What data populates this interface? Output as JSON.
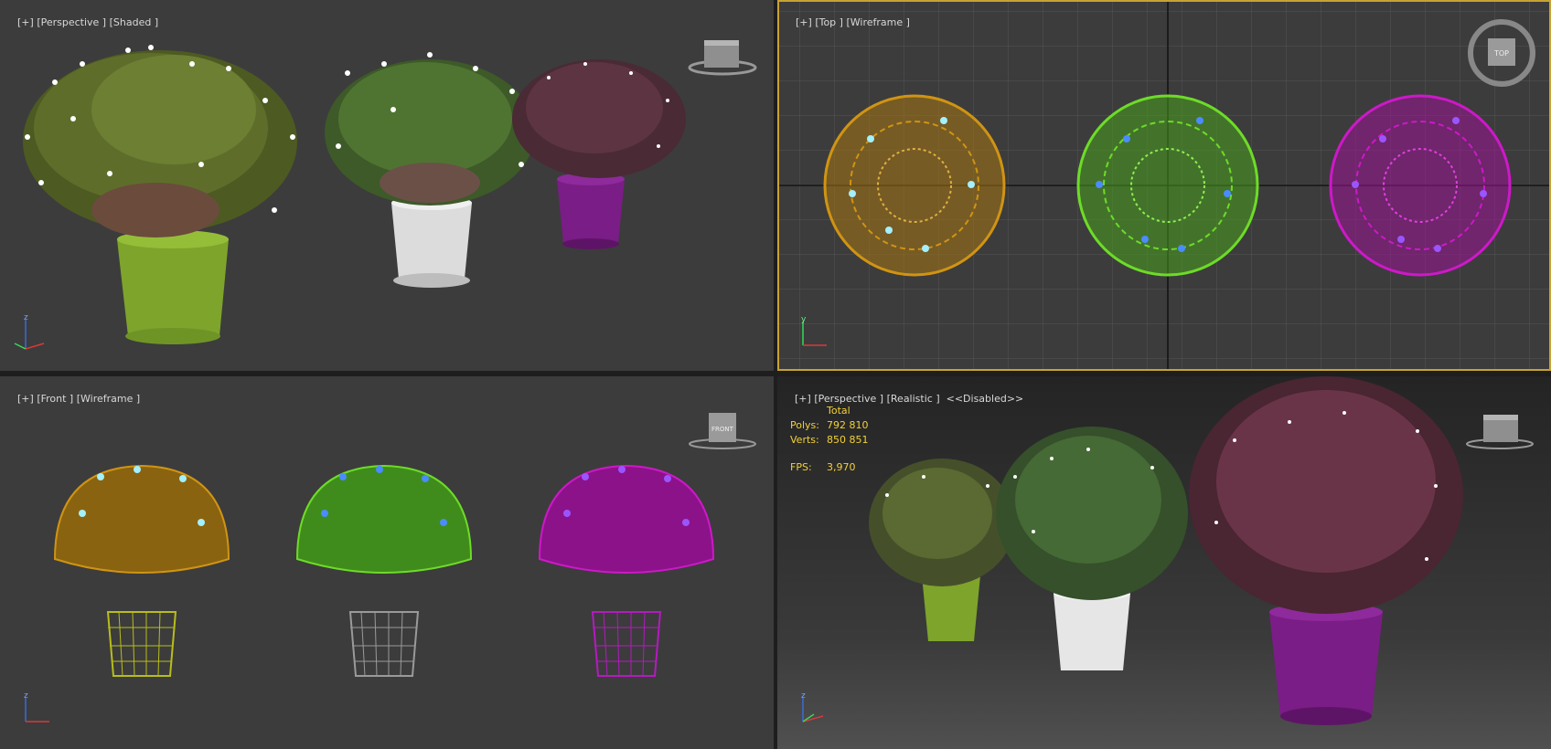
{
  "colors": {
    "viewport_bg": "#3c3c3c",
    "viewport_active_border": "#c8a233",
    "separator": "#1e1e1e",
    "stats_text": "#f3d036",
    "label_text": "#d8d8d8",
    "pot_green": "#8bb231",
    "pot_white": "#e6e6e6",
    "pot_purple": "#7a1d86",
    "wire_orange": "#d09413",
    "wire_green": "#6ddc28",
    "wire_magenta": "#cd19c8",
    "flower_cyan": "#a3f0ff",
    "flower_blue": "#4a8cff",
    "flower_violet": "#9a55ff"
  },
  "viewports": {
    "top_left": {
      "plus": "[+]",
      "view": "[Perspective ]",
      "mode": "[Shaded ]"
    },
    "top_right": {
      "plus": "[+]",
      "view": "[Top ]",
      "mode": "[Wireframe ]",
      "viewcube_label": "TOP"
    },
    "bottom_left": {
      "plus": "[+]",
      "view": "[Front ]",
      "mode": "[Wireframe ]",
      "viewcube_label": "FRONT"
    },
    "bottom_right": {
      "plus": "[+]",
      "view": "[Perspective ]",
      "mode": "[Realistic ]",
      "extra": "<<Disabled>>",
      "stats": {
        "header": "Total",
        "polys_label": "Polys:",
        "polys_value": "792 810",
        "verts_label": "Verts:",
        "verts_value": "850 851",
        "fps_label": "FPS:",
        "fps_value": "3,970"
      }
    }
  },
  "axis": {
    "x": "x",
    "y": "y",
    "z": "z"
  }
}
